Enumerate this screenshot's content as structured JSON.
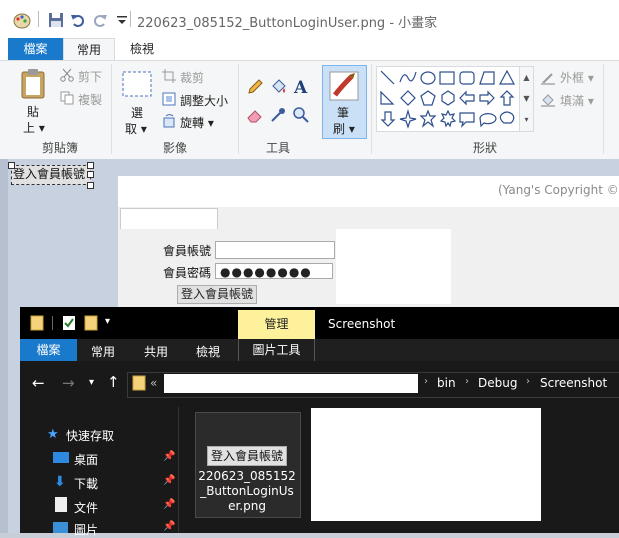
{
  "window": {
    "title": "220623_085152_ButtonLoginUser.png - 小畫家"
  },
  "ribbon": {
    "tabs": [
      "檔案",
      "常用",
      "檢視"
    ],
    "clipboard": {
      "paste": "貼",
      "paste_sub": "上",
      "cut": "剪下",
      "copy": "複製",
      "group": "剪貼簿"
    },
    "image": {
      "select": "選",
      "select_sub": "取",
      "crop": "裁剪",
      "resize": "調整大小",
      "rotate": "旋轉",
      "group": "影像"
    },
    "tools": {
      "group": "工具"
    },
    "brush": {
      "label": "筆",
      "label_sub": "刷"
    },
    "shapes": {
      "outline": "外框",
      "fill": "填滿",
      "group": "形狀"
    }
  },
  "canvas": {
    "selected_button": "登入會員帳號",
    "copyright": "(Yang's Copyright ©",
    "form": {
      "account_label": "會員帳號",
      "password_label": "會員密碼",
      "password_value": "●●●●●●●●",
      "login_button": "登入會員帳號"
    }
  },
  "explorer": {
    "context_tab": "管理",
    "title": "Screenshot",
    "tabs": [
      "檔案",
      "常用",
      "共用",
      "檢視"
    ],
    "context_sub": "圖片工具",
    "path": [
      "«",
      "bin",
      "Debug",
      "Screenshot"
    ],
    "sidebar": [
      {
        "label": "快速存取"
      },
      {
        "label": "桌面"
      },
      {
        "label": "下載"
      },
      {
        "label": "文件"
      },
      {
        "label": "圖片"
      }
    ],
    "file": {
      "thumb_text": "登入會員帳號",
      "name_line1": "220623_085152",
      "name_line2": "_ButtonLoginUs",
      "name_line3": "er.png"
    }
  }
}
